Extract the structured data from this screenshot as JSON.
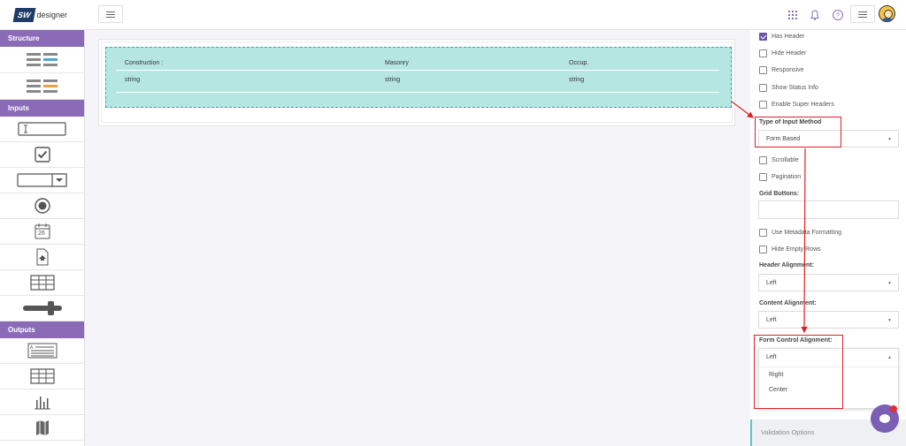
{
  "header": {
    "logo_badge": "SW",
    "logo_text": "designer"
  },
  "sidebar": {
    "sections": [
      {
        "title": "Structure"
      },
      {
        "title": "Inputs"
      },
      {
        "title": "Outputs"
      }
    ],
    "date_tool_day": "26"
  },
  "grid": {
    "columns": [
      "Construction :",
      "Masonry",
      "Occup."
    ],
    "row": [
      "string",
      "string",
      "string"
    ]
  },
  "panel": {
    "has_header": "Has Header",
    "hide_header": "Hide Header",
    "responsive": "Responsive",
    "show_status_info": "Show Status Info",
    "enable_super_headers": "Enable Super Headers",
    "type_of_input_method_label": "Type of Input Method",
    "type_of_input_method_value": "Form Based",
    "scrollable": "Scrollable",
    "pagination": "Pagination",
    "grid_buttons_label": "Grid Buttons:",
    "use_metadata_formatting": "Use Metadata Formatting",
    "hide_empty_rows": "Hide Empty Rows",
    "header_alignment_label": "Header Alignment:",
    "header_alignment_value": "Left",
    "content_alignment_label": "Content Alignment:",
    "content_alignment_value": "Left",
    "form_control_alignment_label": "Form Control Alignment:",
    "form_control_alignment_value": "Left",
    "form_control_alignment_options": [
      "Right",
      "Center"
    ],
    "validation_options": "Validation Options"
  },
  "colors": {
    "accent": "#8b6bb8",
    "grid_fill": "#b6e6e2",
    "annotation": "#e02020"
  }
}
